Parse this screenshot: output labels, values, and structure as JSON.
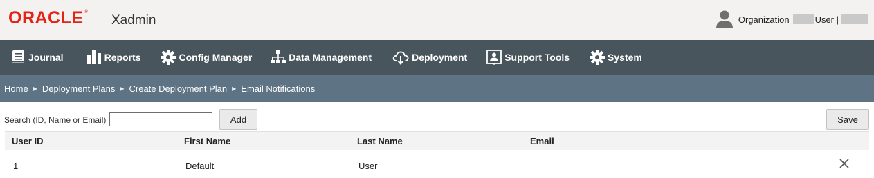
{
  "header": {
    "logo_text": "ORACLE",
    "logo_mark": "®",
    "app_name": "Xadmin",
    "organization_label": "Organization",
    "user_label": "User |",
    "user_icon": "person-icon"
  },
  "nav": {
    "items": [
      {
        "label": "Journal",
        "icon": "journal-icon"
      },
      {
        "label": "Reports",
        "icon": "bar-chart-icon"
      },
      {
        "label": "Config Manager",
        "icon": "gear-icon"
      },
      {
        "label": "Data Management",
        "icon": "hierarchy-icon"
      },
      {
        "label": "Deployment",
        "icon": "cloud-download-icon"
      },
      {
        "label": "Support Tools",
        "icon": "support-person-icon"
      },
      {
        "label": "System",
        "icon": "gear-icon"
      }
    ]
  },
  "breadcrumb": {
    "items": [
      "Home",
      "Deployment Plans",
      "Create Deployment Plan",
      "Email Notifications"
    ]
  },
  "toolbar": {
    "search_label": "Search (ID, Name or Email)",
    "search_value": "",
    "add_label": "Add",
    "save_label": "Save"
  },
  "table": {
    "columns": [
      "User ID",
      "First Name",
      "Last Name",
      "Email"
    ],
    "rows": [
      {
        "user_id": "1",
        "first_name": "Default",
        "last_name": "User",
        "email": ""
      }
    ]
  },
  "colors": {
    "brand_red": "#e32315",
    "nav_bg": "#48555d",
    "breadcrumb_bg": "#5e7485",
    "header_bg": "#f3f2f1"
  }
}
